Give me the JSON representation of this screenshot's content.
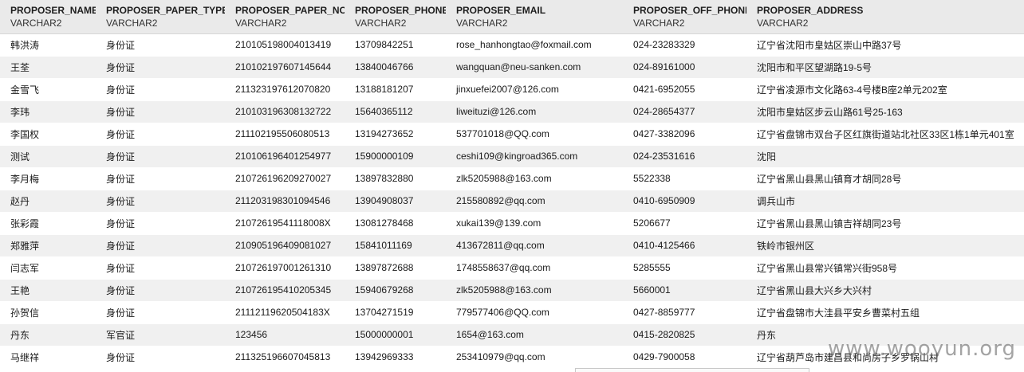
{
  "columns": [
    {
      "name": "PROPOSER_NAME",
      "type": "VARCHAR2"
    },
    {
      "name": "PROPOSER_PAPER_TYPE",
      "type": "VARCHAR2"
    },
    {
      "name": "PROPOSER_PAPER_NO",
      "type": "VARCHAR2"
    },
    {
      "name": "PROPOSER_PHONE",
      "type": "VARCHAR2"
    },
    {
      "name": "PROPOSER_EMAIL",
      "type": "VARCHAR2"
    },
    {
      "name": "PROPOSER_OFF_PHONE",
      "type": "VARCHAR2"
    },
    {
      "name": "PROPOSER_ADDRESS",
      "type": "VARCHAR2"
    }
  ],
  "rows": [
    [
      "韩洪涛",
      "身份证",
      "210105198004013419",
      "13709842251",
      "rose_hanhongtao@foxmail.com",
      "024-23283329",
      "辽宁省沈阳市皇姑区崇山中路37号"
    ],
    [
      "王荃",
      "身份证",
      "210102197607145644",
      "13840046766",
      "wangquan@neu-sanken.com",
      "024-89161000",
      "沈阳市和平区望湖路19-5号"
    ],
    [
      "金雪飞",
      "身份证",
      "211323197612070820",
      "13188181207",
      "jinxuefei2007@126.com",
      "0421-6952055",
      "辽宁省凌源市文化路63-4号楼B座2单元202室"
    ],
    [
      "李玮",
      "身份证",
      "210103196308132722",
      "15640365112",
      "liweituzi@126.com",
      "024-28654377",
      "沈阳市皇姑区步云山路61号25-163"
    ],
    [
      "李国权",
      "身份证",
      "211102195506080513",
      "13194273652",
      "537701018@QQ.com",
      "0427-3382096",
      "辽宁省盘锦市双台子区红旗街道站北社区33区1栋1单元401室"
    ],
    [
      "测试",
      "身份证",
      "210106196401254977",
      "15900000109",
      "ceshi109@kingroad365.com",
      "024-23531616",
      "沈阳"
    ],
    [
      "李月梅",
      "身份证",
      "210726196209270027",
      "13897832880",
      "zlk5205988@163.com",
      "5522338",
      "辽宁省黑山县黑山镇育才胡同28号"
    ],
    [
      "赵丹",
      "身份证",
      "211203198301094546",
      "13904908037",
      "215580892@qq.com",
      "0410-6950909",
      "调兵山市"
    ],
    [
      "张彩霞",
      "身份证",
      "21072619541118008X",
      "13081278468",
      "xukai139@139.com",
      "5206677",
      "辽宁省黑山县黑山镇吉祥胡同23号"
    ],
    [
      "郑雅萍",
      "身份证",
      "210905196409081027",
      "15841011169",
      "413672811@qq.com",
      "0410-4125466",
      "铁岭市银州区"
    ],
    [
      "闫志军",
      "身份证",
      "210726197001261310",
      "13897872688",
      "1748558637@qq.com",
      "5285555",
      "辽宁省黑山县常兴镇常兴街958号"
    ],
    [
      "王艳",
      "身份证",
      "210726195410205345",
      "15940679268",
      "zlk5205988@163.com",
      "5660001",
      "辽宁省黑山县大兴乡大兴村"
    ],
    [
      "孙贺信",
      "身份证",
      "21112119620504183X",
      "13704271519",
      "779577406@QQ.com",
      "0427-8859777",
      "辽宁省盘锦市大洼县平安乡曹菜村五组"
    ],
    [
      "丹东",
      "军官证",
      "123456",
      "15000000001",
      "1654@163.com",
      "0415-2820825",
      "丹东"
    ],
    [
      "马继祥",
      "身份证",
      "211325196607045813",
      "13942969333",
      "253410979@qq.com",
      "0429-7900058",
      "辽宁省葫芦岛市建昌县和尚房子乡罗锅山村"
    ]
  ],
  "watermark": "www.wooyun.org"
}
